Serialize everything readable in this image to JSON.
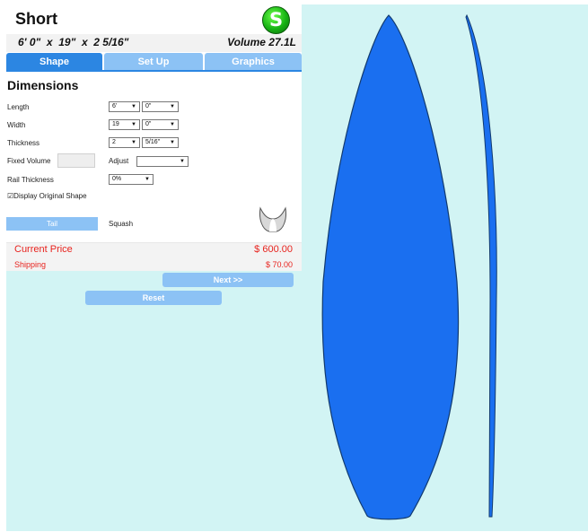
{
  "board": {
    "name": "Short",
    "dimensions": "6' 0\"  x  19\"  x  2 5/16\"",
    "volume": "Volume 27.1L",
    "logo_symbol": "S",
    "brand_color": "#2c86e2",
    "board_color": "#1a6ff0"
  },
  "tabs": [
    {
      "label": "Shape",
      "active": true
    },
    {
      "label": "Set Up",
      "active": false
    },
    {
      "label": "Graphics",
      "active": false
    }
  ],
  "shape": {
    "section_title": "Dimensions",
    "length": {
      "label": "Length",
      "feet": "6'",
      "inches": "0\""
    },
    "width": {
      "label": "Width",
      "inches": "19",
      "fraction": "0\""
    },
    "thickness": {
      "label": "Thickness",
      "inches": "2",
      "fraction": "5/16\""
    },
    "fixed_volume": {
      "label": "Fixed Volume",
      "value": ""
    },
    "adjust": {
      "label": "Adjust",
      "value": ""
    },
    "rail_thickness": {
      "label": "Rail Thickness",
      "value": "0%"
    },
    "display_original": {
      "label": "Display Original Shape",
      "checked": true
    },
    "tail": {
      "button_label": "Tail",
      "value": "Squash",
      "icon": "squash-tail-icon"
    }
  },
  "pricing": {
    "price_label": "Current Price",
    "price_value": "$ 600.00",
    "shipping_label": "Shipping",
    "shipping_value": "$ 70.00",
    "color": "#e8231e"
  },
  "actions": {
    "next_label": "Next >>",
    "reset_label": "Reset"
  }
}
